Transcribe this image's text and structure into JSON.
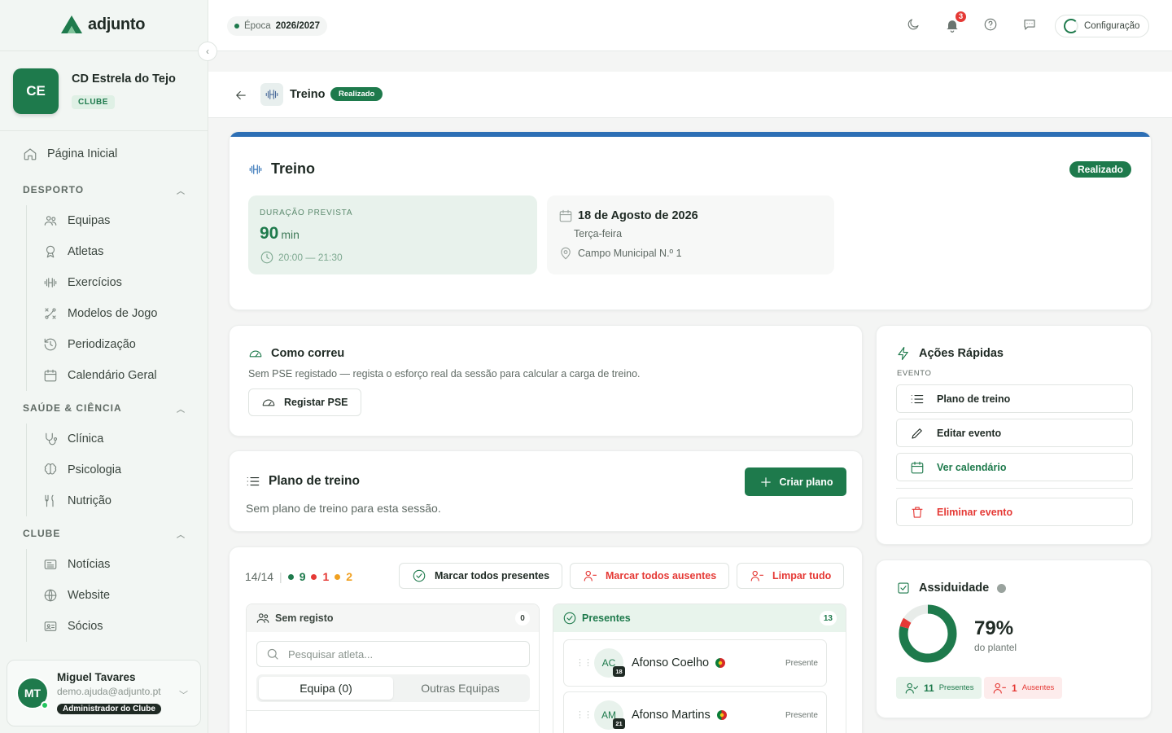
{
  "app": {
    "name": "adjunto"
  },
  "club": {
    "initials": "CE",
    "name": "CD Estrela do Tejo",
    "badge": "CLUBE"
  },
  "nav": {
    "home": "Página Inicial",
    "sections": [
      {
        "title": "DESPORTO",
        "items": [
          "Equipas",
          "Atletas",
          "Exercícios",
          "Modelos de Jogo",
          "Periodização",
          "Calendário Geral"
        ]
      },
      {
        "title": "SAÚDE & CIÊNCIA",
        "items": [
          "Clínica",
          "Psicologia",
          "Nutrição"
        ]
      },
      {
        "title": "CLUBE",
        "items": [
          "Notícias",
          "Website",
          "Sócios"
        ]
      }
    ]
  },
  "user": {
    "initials": "MT",
    "name": "Miguel Tavares",
    "email": "demo.ajuda@adjunto.pt",
    "role": "Administrador do Clube"
  },
  "topbar": {
    "season_label": "Época",
    "season_value": "2026/2027",
    "notifications": "3",
    "config": "Configuração"
  },
  "header": {
    "title": "Treino",
    "status": "Realizado"
  },
  "event": {
    "title": "Treino",
    "status": "Realizado",
    "duration_label": "DURAÇÃO PREVISTA",
    "duration_value": "90",
    "duration_unit": "min",
    "time_range": "20:00 — 21:30",
    "date": "18 de Agosto de 2026",
    "weekday": "Terça-feira",
    "location": "Campo Municipal N.º 1"
  },
  "how": {
    "title": "Como correu",
    "text": "Sem PSE registado — regista o esforço real da sessão para calcular a carga de treino.",
    "button": "Registar PSE"
  },
  "plan": {
    "title": "Plano de treino",
    "text": "Sem plano de treino para esta sessão.",
    "button": "Criar plano"
  },
  "attendance": {
    "total": "14/14",
    "present": "9",
    "absent": "1",
    "late": "2",
    "btn_all_present": "Marcar todos presentes",
    "btn_all_absent": "Marcar todos ausentes",
    "btn_clear": "Limpar tudo",
    "unregistered": {
      "title": "Sem registo",
      "count": "0",
      "search_placeholder": "Pesquisar atleta...",
      "tab_team": "Equipa (0)",
      "tab_other": "Outras Equipas"
    },
    "presents": {
      "title": "Presentes",
      "count": "13",
      "players": [
        {
          "initials": "AC",
          "number": "18",
          "name": "Afonso Coelho",
          "status": "Presente"
        },
        {
          "initials": "AM",
          "number": "21",
          "name": "Afonso Martins",
          "status": "Presente"
        }
      ]
    }
  },
  "actions": {
    "title": "Ações Rápidas",
    "subtitle": "EVENTO",
    "items": [
      "Plano de treino",
      "Editar evento",
      "Ver calendário"
    ],
    "delete": "Eliminar evento"
  },
  "assiduidade": {
    "title": "Assiduidade",
    "percent": "79%",
    "percent_value": 79,
    "subtitle": "do plantel",
    "present_count": "11",
    "present_label": "Presentes",
    "absent_count": "1",
    "absent_label": "Ausentes"
  },
  "colors": {
    "brand": "#1e7a4c",
    "event_stripe": "#2d6fb5",
    "danger": "#e53935",
    "warning": "#f0a020"
  }
}
